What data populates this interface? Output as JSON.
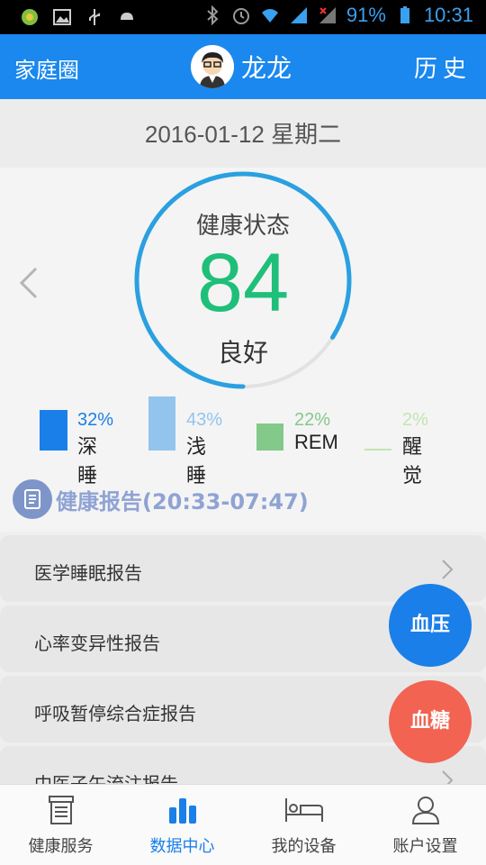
{
  "status": {
    "battery": "91%",
    "time": "10:31"
  },
  "header": {
    "left": "家庭圈",
    "name": "龙龙",
    "right": "历史"
  },
  "date": "2016-01-12 星期二",
  "health": {
    "title": "健康状态",
    "score": "84",
    "score_value": 84,
    "label": "良好"
  },
  "legend": [
    {
      "pct": "32%",
      "label": "深睡",
      "color": "#1a7fe8"
    },
    {
      "pct": "43%",
      "label": "浅睡",
      "color": "#92c4ee"
    },
    {
      "pct": "22%",
      "label": "REM",
      "color": "#82c98a"
    },
    {
      "pct": "2%",
      "label": "醒觉",
      "color": "#c3e4b3"
    }
  ],
  "report": {
    "title": "健康报告(20:33-07:47)"
  },
  "reports": [
    {
      "label": "医学睡眠报告"
    },
    {
      "label": "心率变异性报告"
    },
    {
      "label": "呼吸暂停综合症报告"
    },
    {
      "label": "中医子午流注报告"
    }
  ],
  "fabs": {
    "blood_pressure": "血压",
    "blood_sugar": "血糖"
  },
  "nav": [
    {
      "label": "健康服务",
      "icon": "health-service-icon"
    },
    {
      "label": "数据中心",
      "icon": "data-center-icon"
    },
    {
      "label": "我的设备",
      "icon": "my-device-icon"
    },
    {
      "label": "账户设置",
      "icon": "account-settings-icon"
    }
  ],
  "colors": {
    "primary": "#1a88ee",
    "score": "#1fbf7a",
    "ring": "#2aa0e0",
    "blood_sugar": "#f26352"
  }
}
